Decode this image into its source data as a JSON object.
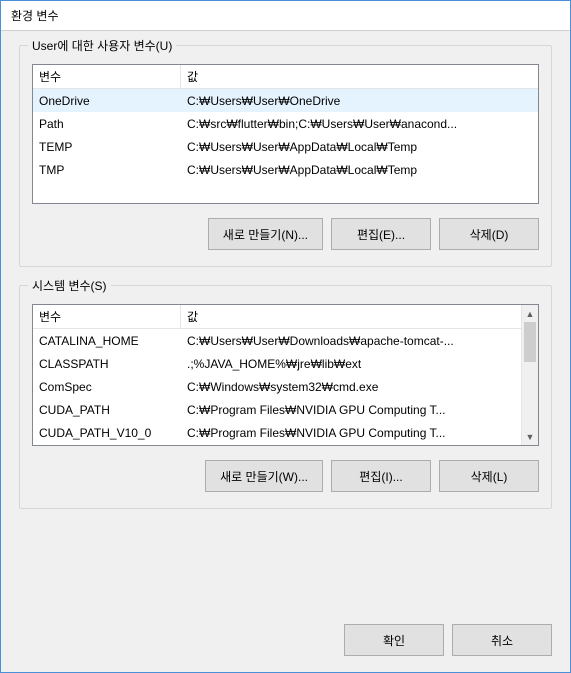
{
  "window": {
    "title": "환경 변수"
  },
  "sections": {
    "user": {
      "legend": "User에 대한 사용자 변수(U)",
      "headers": {
        "name": "변수",
        "value": "값"
      },
      "rows": [
        {
          "name": "OneDrive",
          "value": "C:\\Users\\User\\OneDrive",
          "selected": true
        },
        {
          "name": "Path",
          "value": "C:\\src\\flutter\\bin;C:\\Users\\User\\anacond..."
        },
        {
          "name": "TEMP",
          "value": "C:\\Users\\User\\AppData\\Local\\Temp"
        },
        {
          "name": "TMP",
          "value": "C:\\Users\\User\\AppData\\Local\\Temp"
        }
      ],
      "buttons": {
        "new": "새로 만들기(N)...",
        "edit": "편집(E)...",
        "delete": "삭제(D)"
      }
    },
    "system": {
      "legend": "시스템 변수(S)",
      "headers": {
        "name": "변수",
        "value": "값"
      },
      "rows": [
        {
          "name": "CATALINA_HOME",
          "value": "C:\\Users\\User\\Downloads\\apache-tomcat-..."
        },
        {
          "name": "CLASSPATH",
          "value": ".;%JAVA_HOME%\\jre\\lib\\ext"
        },
        {
          "name": "ComSpec",
          "value": "C:\\Windows\\system32\\cmd.exe"
        },
        {
          "name": "CUDA_PATH",
          "value": "C:\\Program Files\\NVIDIA GPU Computing T..."
        },
        {
          "name": "CUDA_PATH_V10_0",
          "value": "C:\\Program Files\\NVIDIA GPU Computing T..."
        }
      ],
      "buttons": {
        "new": "새로 만들기(W)...",
        "edit": "편집(I)...",
        "delete": "삭제(L)"
      }
    }
  },
  "footer": {
    "ok": "확인",
    "cancel": "취소"
  }
}
